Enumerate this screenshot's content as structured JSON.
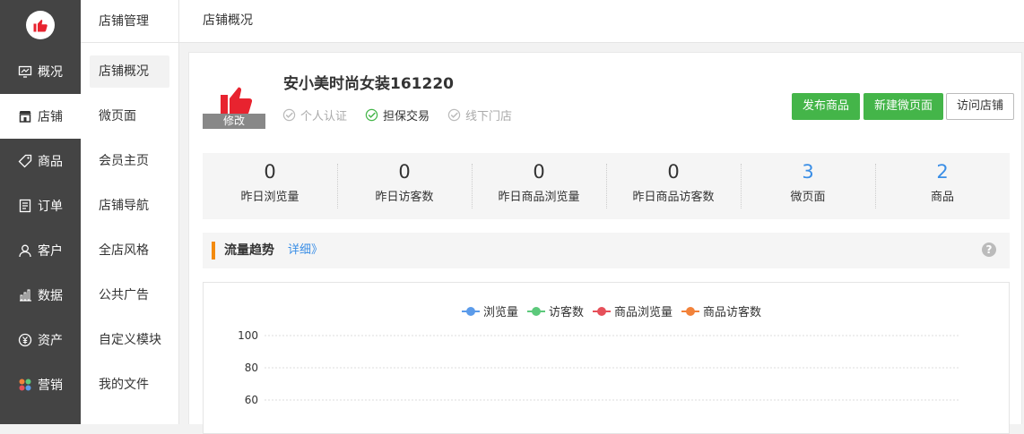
{
  "nav": {
    "items": [
      {
        "label": "概况",
        "icon": "overview-icon"
      },
      {
        "label": "店铺",
        "icon": "store-icon",
        "active": true
      },
      {
        "label": "商品",
        "icon": "tag-icon"
      },
      {
        "label": "订单",
        "icon": "order-icon"
      },
      {
        "label": "客户",
        "icon": "customer-icon"
      },
      {
        "label": "数据",
        "icon": "bar-chart-icon"
      },
      {
        "label": "资产",
        "icon": "yuan-icon"
      },
      {
        "label": "营销",
        "icon": "marketing-icon"
      }
    ]
  },
  "subnav": {
    "title": "店铺管理",
    "items": [
      "店铺概况",
      "微页面",
      "会员主页",
      "店铺导航",
      "全店风格",
      "公共广告",
      "自定义模块",
      "我的文件"
    ]
  },
  "topbar": {
    "title": "店铺概况"
  },
  "shop": {
    "name": "安小美时尚女装161220",
    "logo_edit_label": "修改",
    "badges": [
      {
        "label": "个人认证",
        "checked": false
      },
      {
        "label": "担保交易",
        "checked": true
      },
      {
        "label": "线下门店",
        "checked": false
      }
    ]
  },
  "actions": {
    "publish_label": "发布商品",
    "new_page_label": "新建微页面",
    "visit_label": "访问店铺"
  },
  "stats": [
    {
      "value": "0",
      "label": "昨日浏览量"
    },
    {
      "value": "0",
      "label": "昨日访客数"
    },
    {
      "value": "0",
      "label": "昨日商品浏览量"
    },
    {
      "value": "0",
      "label": "昨日商品访客数"
    },
    {
      "value": "3",
      "label": "微页面",
      "link": true
    },
    {
      "value": "2",
      "label": "商品",
      "link": true
    }
  ],
  "trend": {
    "title": "流量趋势",
    "detail_label": "详细》",
    "help": "?"
  },
  "colors": {
    "accent_green": "#44b549",
    "link_blue": "#3a8ee6",
    "trend_marker": "#f38a0e",
    "nav_bg": "#444444"
  },
  "chart_data": {
    "type": "line",
    "series": [
      {
        "name": "浏览量",
        "color": "#5b9bea",
        "values": []
      },
      {
        "name": "访客数",
        "color": "#5cc97b",
        "values": []
      },
      {
        "name": "商品浏览量",
        "color": "#e6505a",
        "values": []
      },
      {
        "name": "商品访客数",
        "color": "#f2823a",
        "values": []
      }
    ],
    "yticks": [
      100,
      80,
      60
    ],
    "grid": true,
    "legend": "top-center"
  }
}
